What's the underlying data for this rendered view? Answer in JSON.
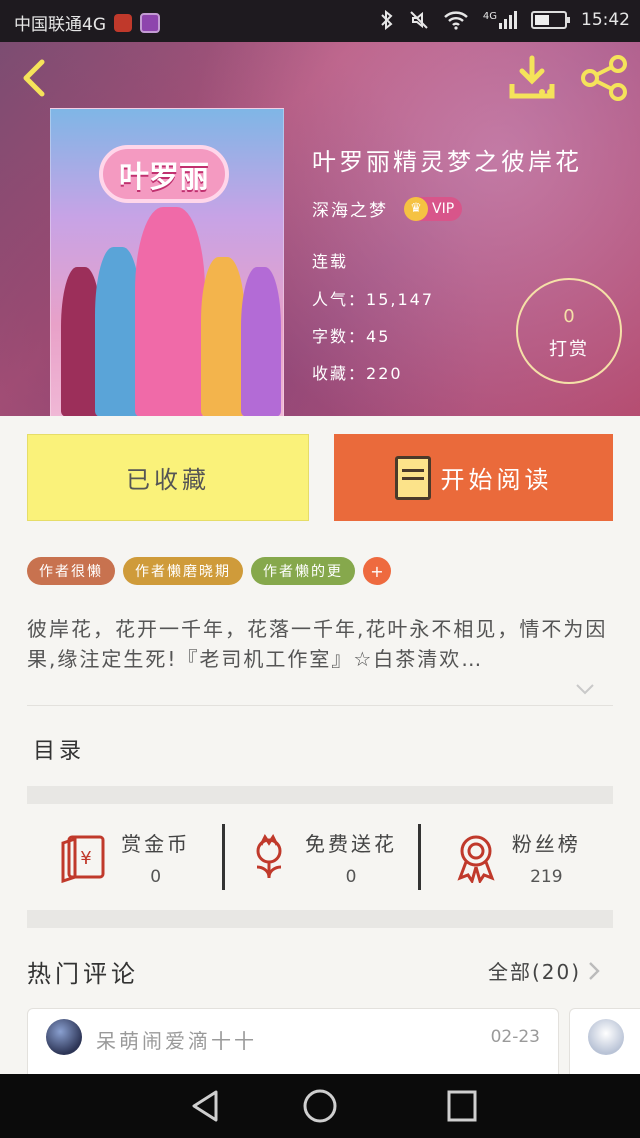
{
  "status_bar": {
    "carrier": "中国联通4G",
    "signal": "4G",
    "time": "15:42"
  },
  "header": {
    "back_icon": "chevron-left-icon",
    "download_icon": "download-icon",
    "share_icon": "share-icon"
  },
  "book": {
    "cover_logo": "叶罗丽",
    "title": "叶罗丽精灵梦之彼岸花",
    "author": "深海之梦",
    "vip": "VIP",
    "status": "连载",
    "popularity_label": "人气：",
    "popularity": "15,147",
    "word_count_label": "字数：",
    "word_count": "45",
    "favorites_label": "收藏：",
    "favorites": "220"
  },
  "reward": {
    "count": "0",
    "label": "打赏"
  },
  "actions": {
    "collected_label": "已收藏",
    "read_label": "开始阅读"
  },
  "tags": [
    {
      "label": "作者很懒",
      "color": "#c8724f"
    },
    {
      "label": "作者懒磨晓期",
      "color": "#cf9b3a"
    },
    {
      "label": "作者懒的更",
      "color": "#86a84c"
    }
  ],
  "tag_more": "+",
  "description": "彼岸花，花开一千年，花落一千年,花叶永不相见，情不为因果,缘注定生死!『老司机工作室』☆白茶清欢…",
  "toc_title": "目录",
  "stats": [
    {
      "label": "赏金币",
      "value": "0",
      "icon": "red-envelope-icon"
    },
    {
      "label": "免费送花",
      "value": "0",
      "icon": "flower-icon"
    },
    {
      "label": "粉丝榜",
      "value": "219",
      "icon": "medal-icon"
    }
  ],
  "comments": {
    "title": "热门评论",
    "all_label": "全部(20)",
    "items": [
      {
        "user": "呆萌闹爱滴十十",
        "date": "02-23"
      }
    ]
  },
  "colors": {
    "accent_orange": "#ea6a3b",
    "collected_yellow": "#faf27a",
    "reward_gold": "#f5e0a8"
  }
}
